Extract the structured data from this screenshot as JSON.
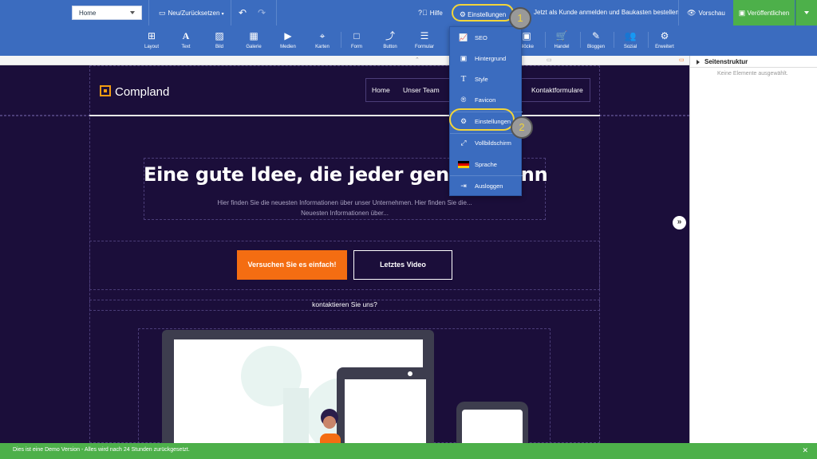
{
  "topbar": {
    "page_select": "Home",
    "reset_label": "Neu/Zurücksetzen",
    "undo_icon": "undo-icon",
    "redo_icon": "redo-icon",
    "help_label": "Hilfe",
    "settings_label": "Einstellungen",
    "customer_login_label": "Jetzt als Kunde anmelden und Baukasten bestellen",
    "preview_label": "Vorschau",
    "publish_label": "Veröffentlichen"
  },
  "tools": [
    {
      "label": "Layout",
      "icon": "layout-icon"
    },
    {
      "label": "Text",
      "icon": "text-icon"
    },
    {
      "label": "Bild",
      "icon": "image-icon"
    },
    {
      "label": "Galerie",
      "icon": "gallery-icon"
    },
    {
      "label": "Medien",
      "icon": "media-icon"
    },
    {
      "label": "Karten",
      "icon": "map-icon"
    },
    {
      "label": "Form",
      "icon": "form-icon"
    },
    {
      "label": "Button",
      "icon": "button-icon"
    },
    {
      "label": "Formular",
      "icon": "formular-icon"
    },
    {
      "label": "Blöcke",
      "icon": "blocks-icon"
    },
    {
      "label": "Handel",
      "icon": "cart-icon"
    },
    {
      "label": "Bloggen",
      "icon": "blog-icon"
    },
    {
      "label": "Sozial",
      "icon": "social-icon"
    },
    {
      "label": "Erweitert",
      "icon": "gears-icon"
    }
  ],
  "settings_menu": {
    "items": [
      {
        "label": "SEO",
        "icon": "chart-icon"
      },
      {
        "label": "Hintergrund",
        "icon": "background-icon"
      },
      {
        "label": "Style",
        "icon": "style-icon"
      },
      {
        "label": "Favicon",
        "icon": "registered-icon"
      },
      {
        "label": "Einstellungen",
        "icon": "gear-icon"
      },
      {
        "label": "Vollbildschirm",
        "icon": "fullscreen-icon"
      },
      {
        "label": "Sprache",
        "icon": "flag-de-icon"
      },
      {
        "label": "Ausloggen",
        "icon": "logout-icon"
      }
    ]
  },
  "callouts": {
    "one": "1",
    "two": "2"
  },
  "sidebar": {
    "title": "Seitenstruktur",
    "empty_text": "Keine Elemente ausgewählt."
  },
  "site": {
    "logo_text": "Compland",
    "nav": [
      "Home",
      "Unser Team",
      "Kontaktformulare"
    ],
    "headline": "Eine gute Idee, die jeder genie",
    "headline_tail": "nn",
    "subtext_line1": "Hier finden Sie die neuesten Informationen über unser Unternehmen. Hier finden Sie die...",
    "subtext_line2": "Neuesten Informationen über...",
    "cta_label": "Versuchen Sie es einfach!",
    "video_label": "Letztes Video",
    "contact_text": "kontaktieren Sie uns?"
  },
  "footer": {
    "notice": "Dies ist eine Demo Version - Alles wird nach 24 Stunden zurückgesetzt.",
    "close_icon": "close-icon"
  },
  "colors": {
    "topbar": "#3b6cbf",
    "canvas": "#1b0e3a",
    "publish": "#4db04a",
    "cta": "#f46d12",
    "highlight": "#f2d53a"
  }
}
